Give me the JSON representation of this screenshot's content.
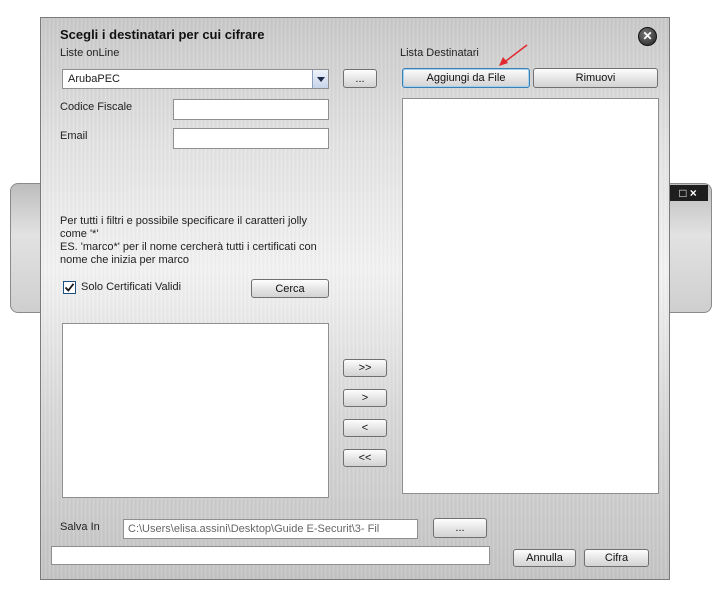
{
  "dialog": {
    "title": "Scegli i destinatari per cui cifrare",
    "close_icon": "close-icon"
  },
  "left": {
    "liste_label": "Liste onLine",
    "liste_selected": "ArubaPEC",
    "browse_label": "...",
    "codice_fiscale_label": "Codice Fiscale",
    "codice_fiscale_value": "",
    "email_label": "Email",
    "email_value": "",
    "info_line1": "Per tutti i filtri e possibile specificare il caratteri jolly",
    "info_line2": "come '*'",
    "info_line3": "ES. 'marco*' per il nome cercherà tutti i certificati con",
    "info_line4": "nome che inizia per marco",
    "solo_validi_label": "Solo Certificati Validi",
    "solo_validi_checked": true,
    "cerca_label": "Cerca"
  },
  "transfer": {
    "add_all": ">>",
    "add_one": ">",
    "remove_one": "<",
    "remove_all": "<<"
  },
  "right": {
    "lista_label": "Lista Destinatari",
    "aggiungi_label": "Aggiungi da File",
    "rimuovi_label": "Rimuovi"
  },
  "bottom": {
    "salva_label": "Salva In",
    "salva_path": "C:\\Users\\elisa.assini\\Desktop\\Guide E-Securit\\3- Fil",
    "salva_browse": "...",
    "status_value": "",
    "annulla_label": "Annulla",
    "cifra_label": "Cifra"
  },
  "background_window": {
    "controls": "□ ×"
  },
  "colors": {
    "annotation_arrow": "#e0282e",
    "focus_border": "#3c7fb1"
  }
}
